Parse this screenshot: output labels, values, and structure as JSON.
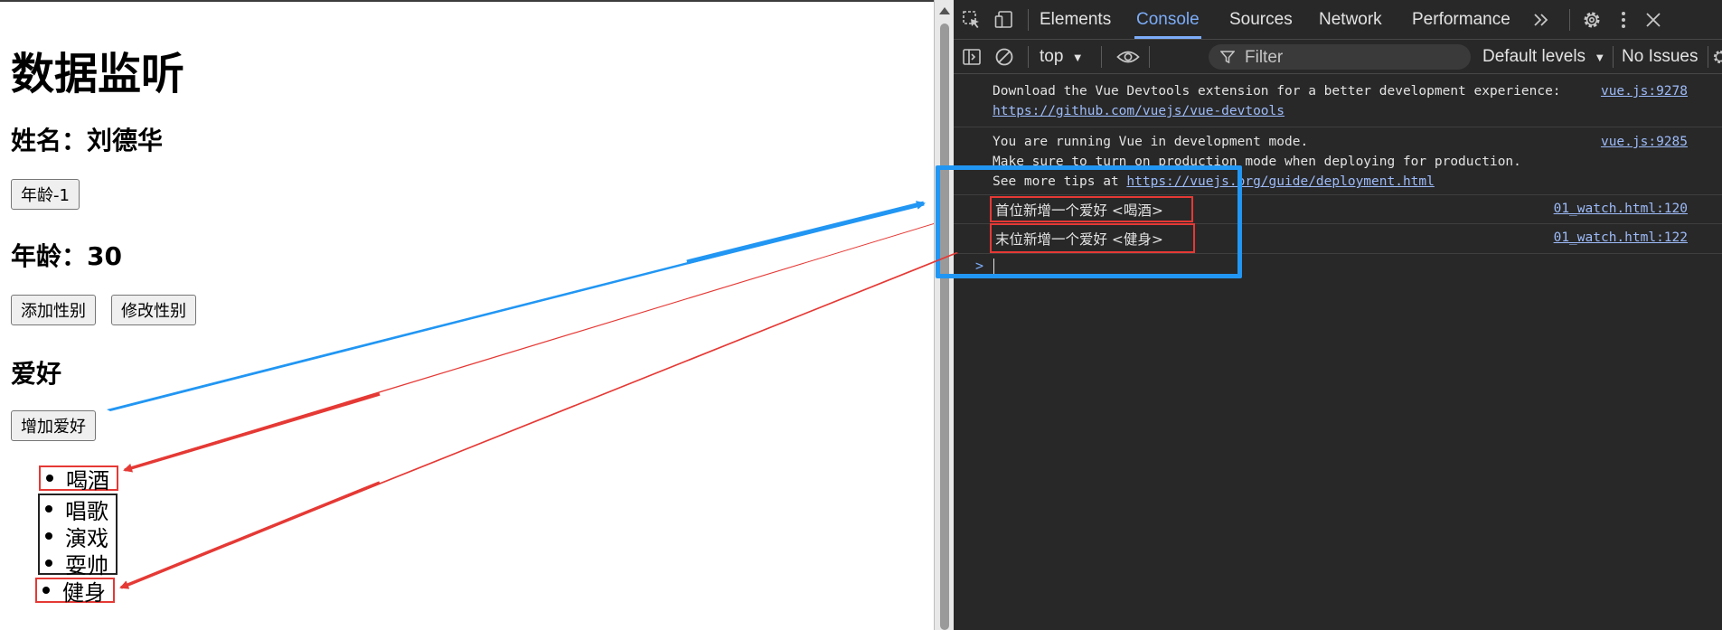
{
  "page": {
    "title": "数据监听",
    "name_line": "姓名：刘德华",
    "age_minus_button": "年龄-1",
    "age_line": "年龄：30",
    "add_gender_button": "添加性别",
    "modify_gender_button": "修改性别",
    "hobbies_heading": "爱好",
    "add_hobby_button": "增加爱好",
    "hobbies": [
      "喝酒",
      "唱歌",
      "演戏",
      "耍帅",
      "健身"
    ]
  },
  "devtools": {
    "tabs": [
      "Elements",
      "Console",
      "Sources",
      "Network",
      "Performance"
    ],
    "active_tab": "Console",
    "more_tabs_icon": "chevrons-right-icon",
    "toolbar": {
      "context": "top",
      "filter_placeholder": "Filter",
      "levels": "Default levels",
      "issues": "No Issues"
    },
    "messages": [
      {
        "line1": "Download the Vue Devtools extension for a better development experience:",
        "link": "https://github.com/vuejs/vue-devtools",
        "source": "vue.js:9278"
      },
      {
        "line1": "You are running Vue in development mode.",
        "line2": "Make sure to turn on production mode when deploying for production.",
        "line3_prefix": "See more tips at ",
        "line3_link": "https://vuejs.org/guide/deployment.html",
        "source": "vue.js:9285"
      },
      {
        "text": "首位新增一个爱好 <喝酒>",
        "source": "01_watch.html:120"
      },
      {
        "text": "末位新增一个爱好 <健身>",
        "source": "01_watch.html:122"
      }
    ],
    "prompt": ">"
  },
  "colors": {
    "annotation_red": "#e53935",
    "annotation_blue": "#2196f3",
    "devtools_bg": "#282828",
    "active_tab": "#7cacf8",
    "link": "#9dbbf9"
  }
}
